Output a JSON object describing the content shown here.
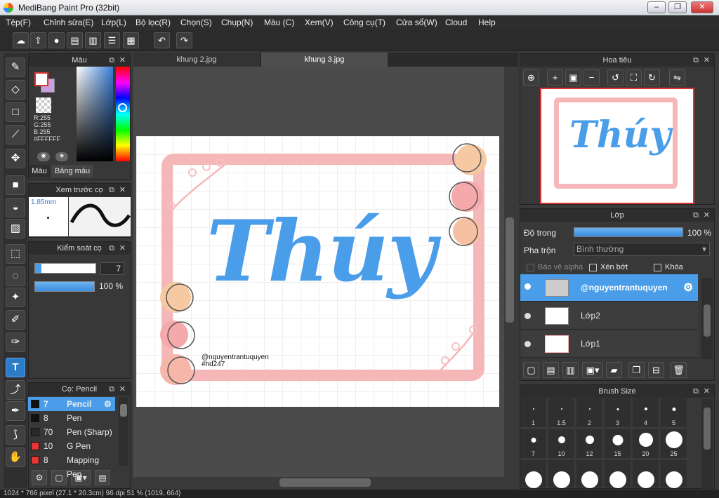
{
  "window": {
    "title": "MediBang Paint Pro (32bit)"
  },
  "menu": [
    "Tệp(F)",
    "Chỉnh sửa(E)",
    "Lớp(L)",
    "Bộ lọc(R)",
    "Chọn(S)",
    "Chụp(N)",
    "Màu (C)",
    "Xem(V)",
    "Công cụ(T)",
    "Cửa sổ(W)",
    "Cloud",
    "Help"
  ],
  "color_panel": {
    "title": "Màu",
    "r": "R:255",
    "g": "G:255",
    "b": "B:255",
    "hex": "#FFFFFF",
    "tab_color": "Màu",
    "tab_palette": "Bảng màu"
  },
  "preview_panel": {
    "title": "Xem trước cọ",
    "size": "1.85mm"
  },
  "control_panel": {
    "title": "Kiểm soát cọ",
    "size_value": "7",
    "opacity_value": "100 %"
  },
  "brush_panel": {
    "title": "Cọ: Pencil",
    "items": [
      {
        "size": "7",
        "name": "Pencil",
        "color": "#111111",
        "selected": true
      },
      {
        "size": "8",
        "name": "Pen",
        "color": "#111111"
      },
      {
        "size": "70",
        "name": "Pen (Sharp)",
        "color": "#2a2a2a"
      },
      {
        "size": "10",
        "name": "G Pen",
        "color": "#e53535"
      },
      {
        "size": "8",
        "name": "Mapping Pen",
        "color": "#e53535"
      }
    ]
  },
  "tabs": [
    "khung 2.jpg",
    "khung 3.jpg"
  ],
  "canvas": {
    "title_art": "Thúy",
    "credit": "@nguyentrantuquyen",
    "tag": "#hd247"
  },
  "navigator": {
    "title": "Hoa tiêu"
  },
  "layer_panel": {
    "title": "Lớp",
    "opacity_label": "Độ trong",
    "opacity_value": "100 %",
    "blend_label": "Pha trộn",
    "blend_value": "Bình thường",
    "alpha_label": "Bảo vệ alpha",
    "clip_label": "Xén bớt",
    "lock_label": "Khóa",
    "layers": [
      "@nguyentrantuquyen",
      "Lớp2",
      "Lớp1"
    ]
  },
  "brush_size_panel": {
    "title": "Brush Size",
    "sizes": [
      "1",
      "1.5",
      "2",
      "3",
      "4",
      "5",
      "7",
      "10",
      "12",
      "15",
      "20",
      "25"
    ]
  },
  "status": "1024 * 766 pixel (27.1 * 20.3cm) 96 dpi 51 % (1019, 664)",
  "colors": {
    "accent": "#4a9de8",
    "pink": "#f5b7b8",
    "peach": "#f7c9a3"
  }
}
